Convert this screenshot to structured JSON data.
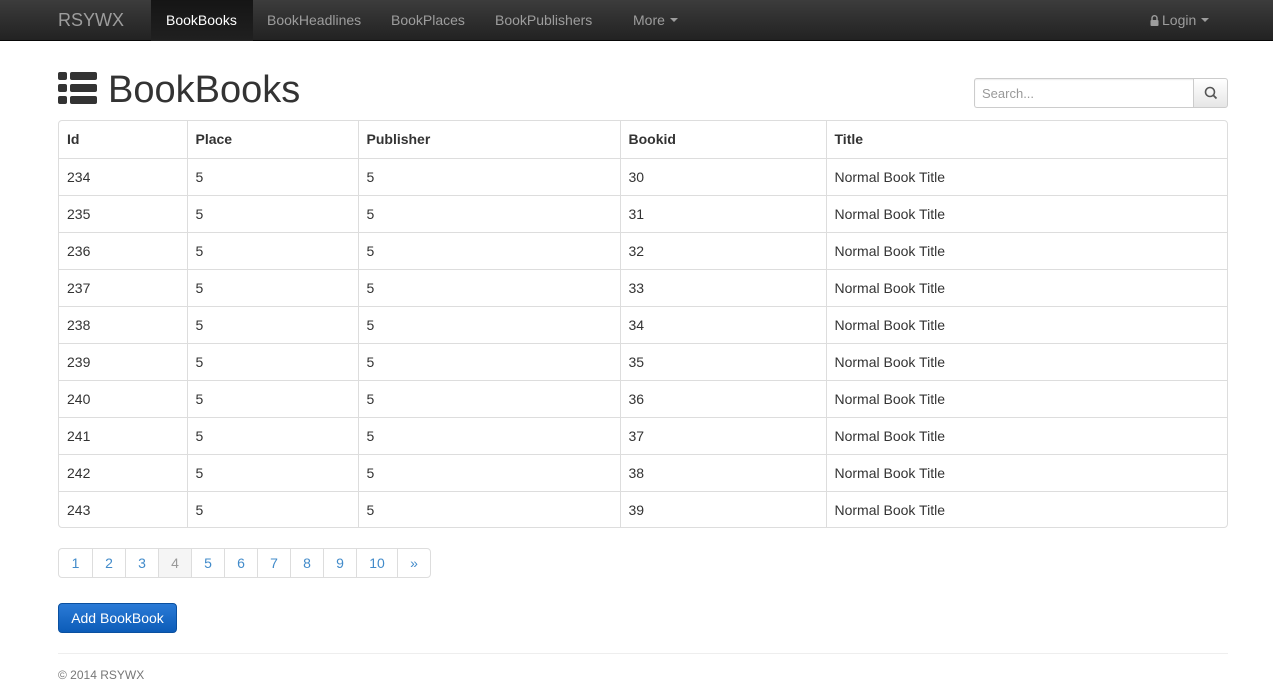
{
  "navbar": {
    "brand": "RSYWX",
    "items": [
      {
        "label": "BookBooks",
        "active": true
      },
      {
        "label": "BookHeadlines"
      },
      {
        "label": "BookPlaces"
      },
      {
        "label": "BookPublishers"
      },
      {
        "label": "More"
      }
    ],
    "login": "Login"
  },
  "page": {
    "title": "BookBooks",
    "icon": "list-icon"
  },
  "search": {
    "placeholder": "Search...",
    "icon": "search-icon"
  },
  "table": {
    "headers": [
      "Id",
      "Place",
      "Publisher",
      "Bookid",
      "Title"
    ],
    "rows": [
      [
        "234",
        "5",
        "5",
        "30",
        "Normal Book Title"
      ],
      [
        "235",
        "5",
        "5",
        "31",
        "Normal Book Title"
      ],
      [
        "236",
        "5",
        "5",
        "32",
        "Normal Book Title"
      ],
      [
        "237",
        "5",
        "5",
        "33",
        "Normal Book Title"
      ],
      [
        "238",
        "5",
        "5",
        "34",
        "Normal Book Title"
      ],
      [
        "239",
        "5",
        "5",
        "35",
        "Normal Book Title"
      ],
      [
        "240",
        "5",
        "5",
        "36",
        "Normal Book Title"
      ],
      [
        "241",
        "5",
        "5",
        "37",
        "Normal Book Title"
      ],
      [
        "242",
        "5",
        "5",
        "38",
        "Normal Book Title"
      ],
      [
        "243",
        "5",
        "5",
        "39",
        "Normal Book Title"
      ]
    ]
  },
  "pagination": {
    "pages": [
      "1",
      "2",
      "3",
      "4",
      "5",
      "6",
      "7",
      "8",
      "9",
      "10",
      "»"
    ],
    "current": "4"
  },
  "actions": {
    "add_label": "Add BookBook"
  },
  "footer": {
    "text": "© 2014 RSYWX"
  },
  "colors": {
    "accent": "#428bca",
    "primary_button": "#1565c8",
    "navbar": "#222222"
  }
}
